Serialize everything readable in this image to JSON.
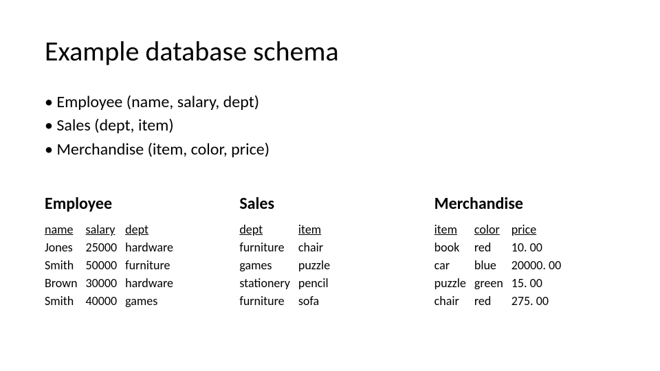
{
  "title": "Example database schema",
  "bullets": [
    "• Employee (name, salary, dept)",
    "• Sales (dept, item)",
    "• Merchandise (item, color, price)"
  ],
  "tables": {
    "employee": {
      "title": "Employee",
      "headers": [
        "name",
        "salary",
        "dept"
      ],
      "rows": [
        [
          "Jones",
          "25000",
          "hardware"
        ],
        [
          "Smith",
          "50000",
          "furniture"
        ],
        [
          "Brown",
          "30000",
          "hardware"
        ],
        [
          "Smith",
          "40000",
          "games"
        ]
      ]
    },
    "sales": {
      "title": "Sales",
      "headers": [
        "dept",
        "item"
      ],
      "rows": [
        [
          "furniture",
          "chair"
        ],
        [
          "games",
          "puzzle"
        ],
        [
          "stationery",
          "pencil"
        ],
        [
          "furniture",
          "sofa"
        ]
      ]
    },
    "merchandise": {
      "title": "Merchandise",
      "headers": [
        "item",
        "color",
        "price"
      ],
      "rows": [
        [
          "book",
          "red",
          "10. 00"
        ],
        [
          "car",
          "blue",
          "20000. 00"
        ],
        [
          "puzzle",
          "green",
          "15. 00"
        ],
        [
          "chair",
          "red",
          "275. 00"
        ]
      ]
    }
  }
}
